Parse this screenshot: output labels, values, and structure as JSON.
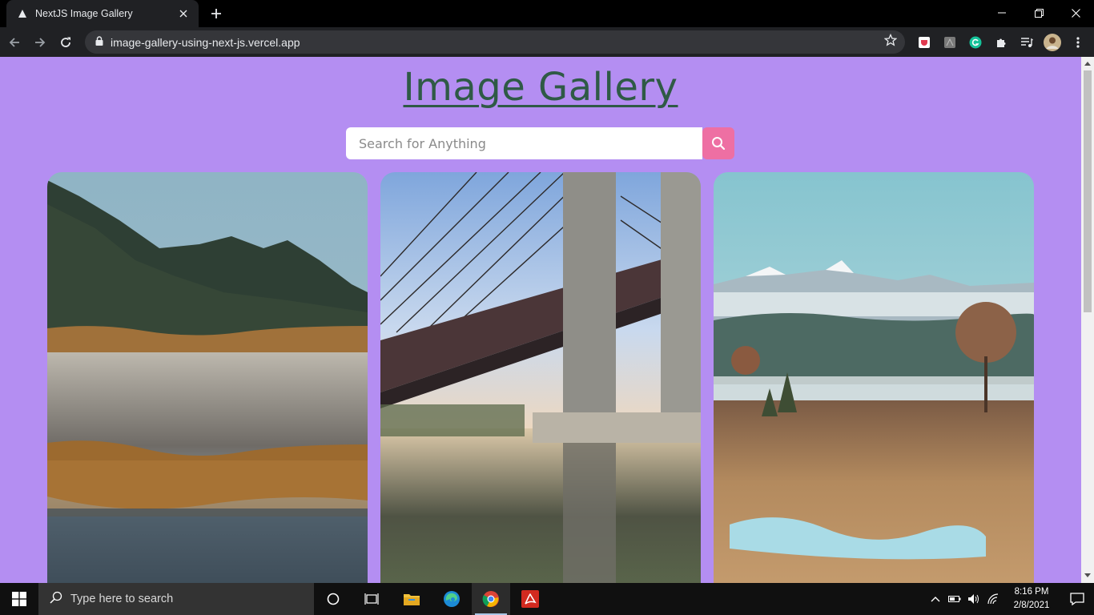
{
  "browser": {
    "tab": {
      "title": "NextJS Image Gallery"
    },
    "url": "image-gallery-using-next-js.vercel.app"
  },
  "page": {
    "title": "Image Gallery",
    "search": {
      "placeholder": "Search for Anything",
      "value": ""
    },
    "colors": {
      "background": "#b48ef2",
      "title": "#2f5a46",
      "search_button": "#ee6fa3"
    },
    "images": [
      {
        "subject": "mountain lake with reeds"
      },
      {
        "subject": "concrete cable bridge reflected in water"
      },
      {
        "subject": "snowy mountains above misty meadow"
      }
    ]
  },
  "taskbar": {
    "search_placeholder": "Type here to search",
    "time": "8:16 PM",
    "date": "2/8/2021"
  }
}
